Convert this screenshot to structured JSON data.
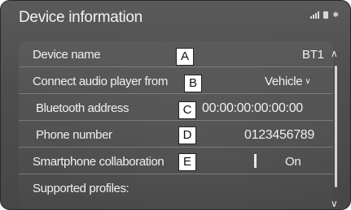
{
  "header": {
    "title": "Device information"
  },
  "rows": [
    {
      "label": "Device name",
      "value": "BT1",
      "callout": "A"
    },
    {
      "label": "Connect audio player from",
      "value": "Vehicle",
      "callout": "B"
    },
    {
      "label": "Bluetooth address",
      "value": "00:00:00:00:00:00",
      "callout": "C"
    },
    {
      "label": "Phone number",
      "value": "0123456789",
      "callout": "D"
    },
    {
      "label": "Smartphone collaboration",
      "value": "On",
      "callout": "E"
    },
    {
      "label": "Supported profiles:"
    }
  ],
  "icons": {
    "signal": "signal-strength-icon",
    "battery": "battery-icon",
    "bluetooth": "bluetooth-icon",
    "scroll_up": "chevron-up-icon",
    "scroll_down": "chevron-down-icon",
    "dropdown": "chevron-down-icon"
  }
}
